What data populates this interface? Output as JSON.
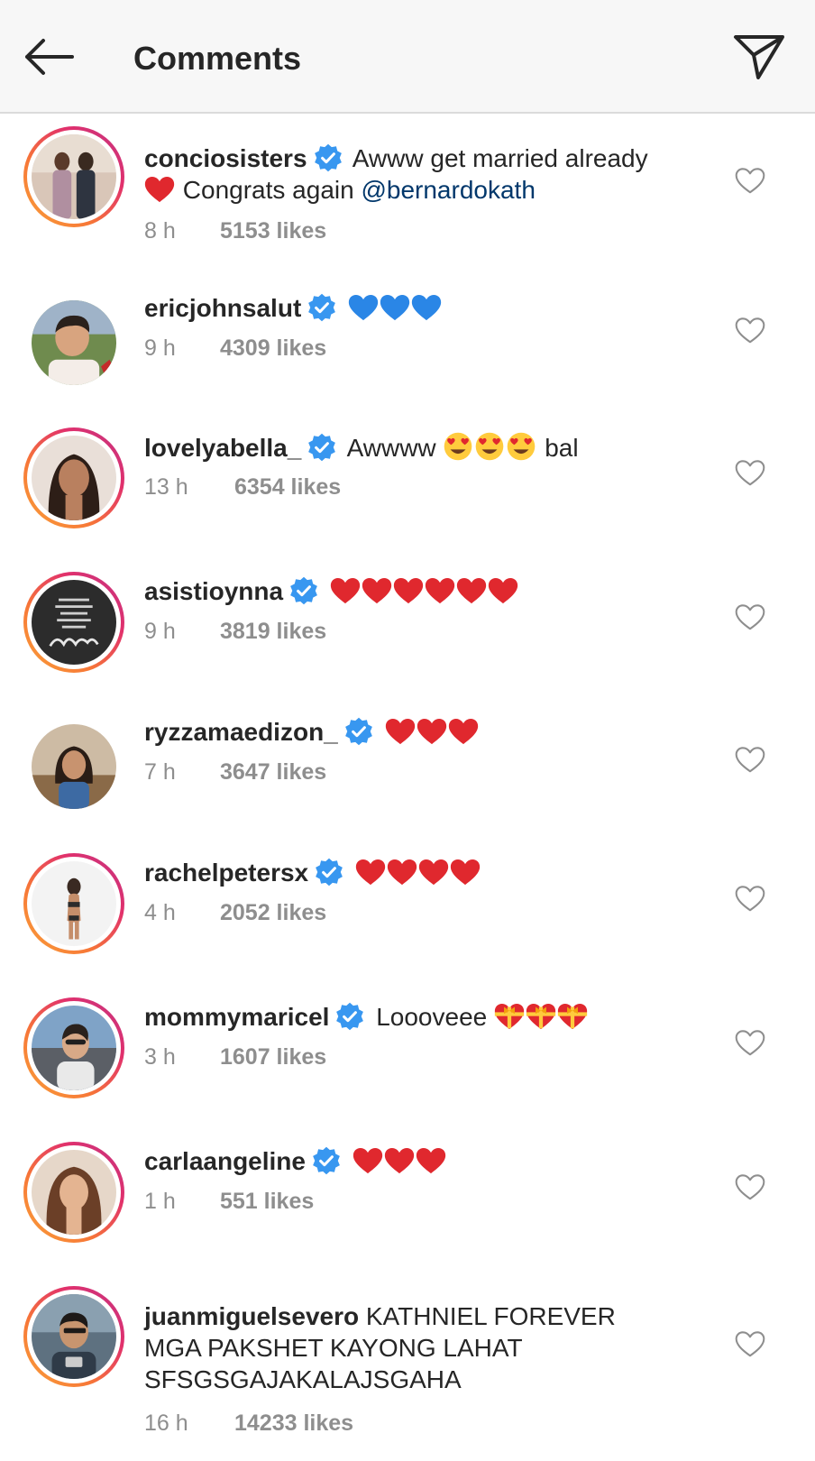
{
  "header": {
    "title": "Comments",
    "back_icon": "arrow-left-icon",
    "share_icon": "paper-plane-icon"
  },
  "colors": {
    "heart_red": "#e0282e",
    "blue_heart": "#2a86e6",
    "verified_blue": "#3897f0",
    "mention": "#00376b",
    "muted": "#8e8e8e"
  },
  "comments": [
    {
      "username": "conciosisters",
      "verified": true,
      "line1": "Awww get married already",
      "line2_text": "Congrats again",
      "mention": "@bernardokath",
      "time": "8 h",
      "likes": "5153 likes"
    },
    {
      "username": "ericjohnsalut",
      "verified": true,
      "emoji": "blue-heart x3",
      "time": "9 h",
      "likes": "4309 likes"
    },
    {
      "username": "lovelyabella_",
      "verified": true,
      "text_before": "Awwww",
      "emoji": "heart-eyes x3",
      "text_after": "bal",
      "time": "13 h",
      "likes": "6354 likes"
    },
    {
      "username": "asistioynna",
      "verified": true,
      "emoji": "red-heart x6",
      "time": "9 h",
      "likes": "3819 likes"
    },
    {
      "username": "ryzzamaedizon_",
      "verified": true,
      "emoji": "red-heart x3",
      "time": "7 h",
      "likes": "3647 likes"
    },
    {
      "username": "rachelpetersx",
      "verified": true,
      "emoji": "red-heart x4",
      "time": "4 h",
      "likes": "2052 likes"
    },
    {
      "username": "mommymaricel",
      "verified": true,
      "text_before": "Loooveee",
      "emoji": "gift-heart x3",
      "time": "3 h",
      "likes": "1607 likes"
    },
    {
      "username": "carlaangeline",
      "verified": true,
      "emoji": "red-heart x3",
      "time": "1 h",
      "likes": "551 likes"
    },
    {
      "username": "juanmiguelsevero",
      "verified": false,
      "line1": "KATHNIEL FOREVER",
      "line2": "MGA PAKSHET KAYONG LAHAT",
      "line3": "SFSGSGAJAKALAJSGAHA",
      "time": "16 h",
      "likes": "14233 likes"
    }
  ]
}
